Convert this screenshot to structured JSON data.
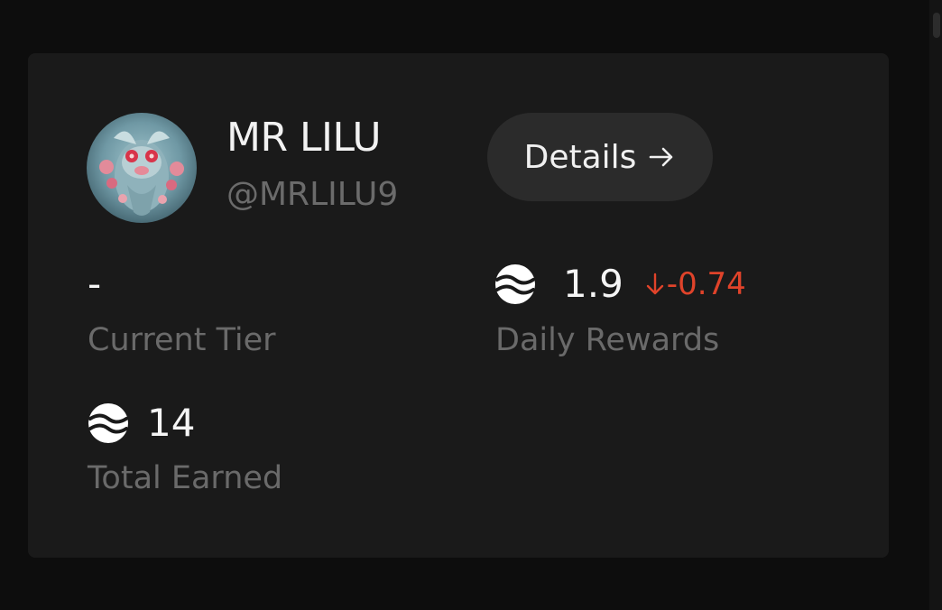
{
  "profile": {
    "name": "MR LILU",
    "handle": "@MRLILU9"
  },
  "details_button": {
    "label": "Details",
    "icon": "arrow-right-icon"
  },
  "stats": {
    "current_tier": {
      "value": "-",
      "label": "Current Tier"
    },
    "daily_rewards": {
      "value": "1.9",
      "delta": "-0.74",
      "delta_direction": "down",
      "label": "Daily Rewards",
      "icon": "token-icon"
    },
    "total_earned": {
      "value": "14",
      "label": "Total Earned",
      "icon": "token-icon"
    }
  },
  "colors": {
    "card_background": "#1a1a1a",
    "page_background": "#0d0d0d",
    "negative_delta": "#e0432a",
    "muted_text": "#6a6a6a"
  }
}
